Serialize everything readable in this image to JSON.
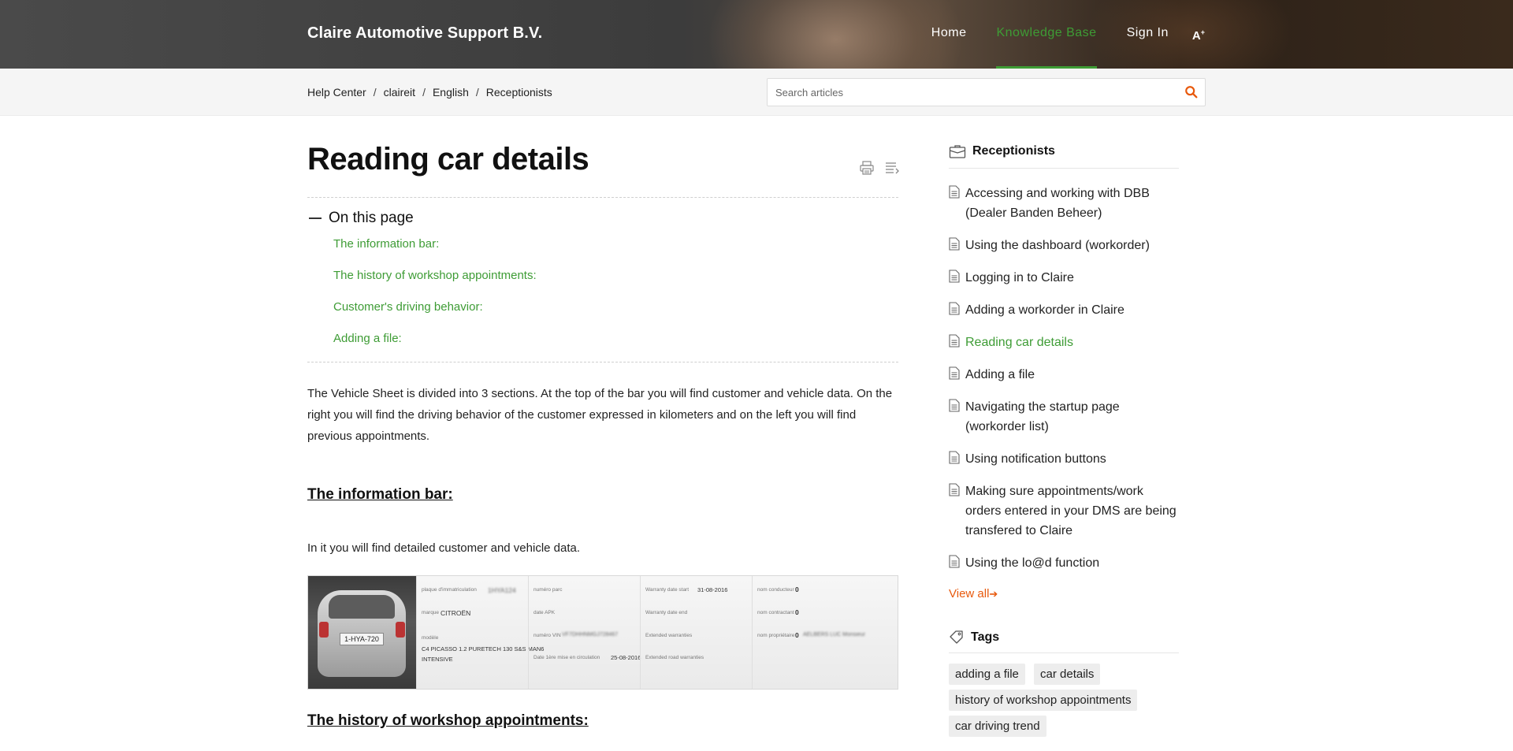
{
  "header": {
    "brand": "Claire Automotive Support B.V.",
    "nav": [
      {
        "label": "Home"
      },
      {
        "label": "Knowledge Base"
      },
      {
        "label": "Sign In"
      }
    ],
    "accessibility_label": "A",
    "accent_color": "#3e9c35"
  },
  "breadcrumb": [
    "Help Center",
    "claireit",
    "English",
    "Receptionists"
  ],
  "search": {
    "placeholder": "Search articles",
    "icon": "search-icon",
    "icon_color": "#e8590c"
  },
  "article": {
    "title": "Reading car details",
    "tools": [
      "print-icon",
      "reading-mode-icon"
    ],
    "toc": {
      "heading": "On this page",
      "links": [
        "The information bar:",
        "The history of workshop appointments:",
        "Customer's driving behavior:",
        "Adding a file:"
      ]
    },
    "intro": "The Vehicle Sheet is divided into 3 sections. At the top of the bar you will find customer and vehicle data. On the right you will find the driving behavior of the customer expressed in kilometers and on the left you will find previous appointments.",
    "section1_heading": "The information bar:",
    "section1_text": "In it you will find detailed customer and vehicle data.",
    "section2_heading": "The history of workshop appointments:",
    "vehicle_sheet": {
      "plate": "1-HYA-720",
      "col1": {
        "f1": "plaque d'immatriculation",
        "v1": "1HYA124",
        "f2": "marque",
        "v2": "CITROËN",
        "f3": "modèle",
        "v3": "C4 PICASSO 1.2 PURETECH 130 S&S MAN6",
        "v3b": "INTENSIVE"
      },
      "col2": {
        "f1": "numéro parc",
        "f2": "date APK",
        "f3": "numéro VIN",
        "v3": "VF7DHHNMGJ728467",
        "f4": "Date 1ère mise en circulation",
        "v4": "25-08-2016"
      },
      "col3": {
        "f1": "Warranty date start",
        "v1": "31-08-2016",
        "f2": "Warranty date end",
        "f3": "Extended warranties",
        "f4": "Extended road warranties"
      },
      "col4": {
        "f1": "nom conducteur",
        "v1": "0",
        "f2": "nom contractant",
        "v2": "0",
        "f3": "nom propriétaire",
        "v3": "0",
        "v3b": "AELBERS LUC Monsieur"
      }
    }
  },
  "sidebar": {
    "section_title": "Receptionists",
    "items": [
      "Accessing and working with DBB (Dealer Banden Beheer)",
      "Using the dashboard (workorder)",
      "Logging in to Claire",
      "Adding a workorder in Claire",
      "Reading car details",
      "Adding a file",
      "Navigating the startup page (workorder list)",
      "Using notification buttons",
      "Making sure appointments/work orders entered in your DMS are being transfered to Claire",
      "Using the lo@d function"
    ],
    "active_item": "Reading car details",
    "view_all": "View all",
    "view_all_color": "#e8590c",
    "tags_title": "Tags",
    "tags": [
      "adding a file",
      "car details",
      "history of workshop appointments",
      "car driving trend"
    ]
  }
}
